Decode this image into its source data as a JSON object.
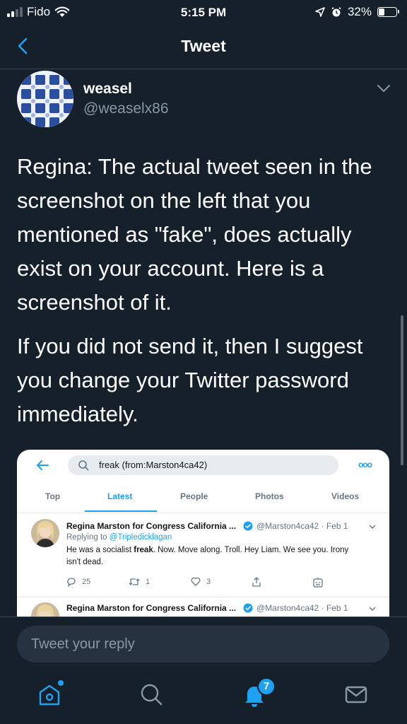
{
  "status_bar": {
    "carrier": "Fido",
    "time": "5:15 PM",
    "battery": "32%",
    "battery_level": 0.32,
    "signal_bars_active": 2
  },
  "header": {
    "title": "Tweet",
    "back_icon": "chevron-left-icon"
  },
  "tweet": {
    "author_name": "weasel",
    "author_handle": "@weaselx86",
    "paragraph_1": "Regina:  The actual tweet seen in the screenshot on the left that you mentioned as \"fake\", does actually exist on your account.  Here is a screenshot of it.",
    "paragraph_2": "If you did not send it, then I suggest you change your Twitter password immediately."
  },
  "embedded_screenshot": {
    "search_query": "freak (from:Marston4ca42)",
    "tabs": [
      "Top",
      "Latest",
      "People",
      "Photos",
      "Videos"
    ],
    "active_tab": "Latest",
    "results": [
      {
        "name": "Regina Marston for Congress California ...",
        "handle_date": "@Marston4ca42 · Feb 1",
        "replying_prefix": "Replying to ",
        "replying_to": "@Tripledicklagan",
        "text_before": "He was a socialist ",
        "text_bold": "freak",
        "text_after": ". Now. Move along. Troll. Hey Liam. We see you. Irony isn't dead.",
        "replies": "25",
        "retweets": "1",
        "likes": "3"
      },
      {
        "name": "Regina Marston for Congress California ...",
        "handle_date": "@Marston4ca42 · Feb 1"
      }
    ]
  },
  "reply_bar": {
    "placeholder": "Tweet your reply"
  },
  "tab_bar": {
    "notifications_badge": "7",
    "icons": [
      "home-icon",
      "search-icon",
      "notifications-icon",
      "messages-icon"
    ]
  },
  "colors": {
    "background": "#15202b",
    "accent": "#1da1f2",
    "muted": "#8899a6",
    "divider": "#38444d"
  }
}
